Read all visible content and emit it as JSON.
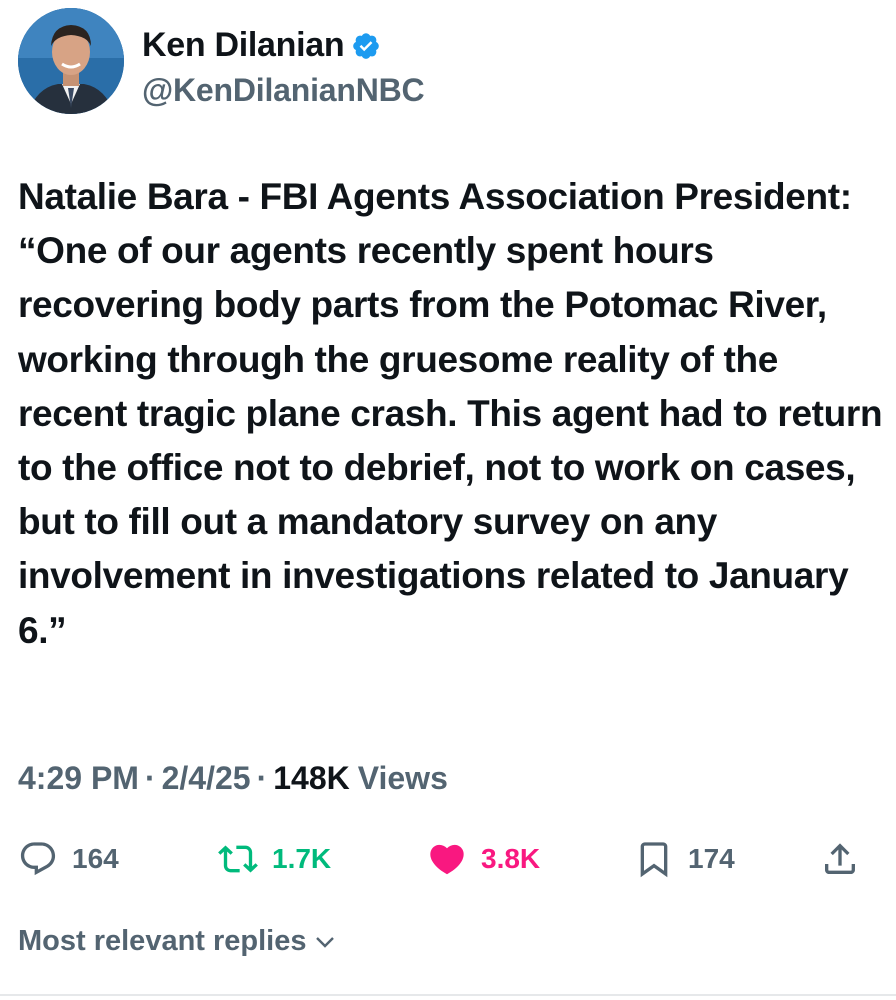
{
  "author": {
    "name": "Ken Dilanian",
    "handle": "@KenDilanianNBC",
    "verified_icon": "verified-badge-icon",
    "verified_color": "#1d9bf0"
  },
  "tweet": {
    "text": "Natalie Bara - FBI Agents Association President:\n“One of our agents recently spent hours recovering body parts from the Potomac River, working through the gruesome reality of the recent tragic plane crash. This agent had to return to the office not to debrief, not to work on cases, but to fill out a mandatory survey on any involvement in investigations related to January 6.”"
  },
  "meta": {
    "time": "4:29 PM",
    "separator": "·",
    "date": "2/4/25",
    "views_count": "148K",
    "views_label": "Views"
  },
  "actions": {
    "reply": {
      "icon": "reply-icon",
      "count": "164",
      "color": "#536471"
    },
    "retweet": {
      "icon": "retweet-icon",
      "count": "1.7K",
      "color": "#00ba7c"
    },
    "like": {
      "icon": "heart-icon",
      "count": "3.8K",
      "color": "#f91880"
    },
    "bookmark": {
      "icon": "bookmark-icon",
      "count": "174",
      "color": "#536471"
    },
    "share": {
      "icon": "share-icon"
    }
  },
  "replies": {
    "sort_label": "Most relevant replies",
    "icon": "chevron-down-icon"
  }
}
